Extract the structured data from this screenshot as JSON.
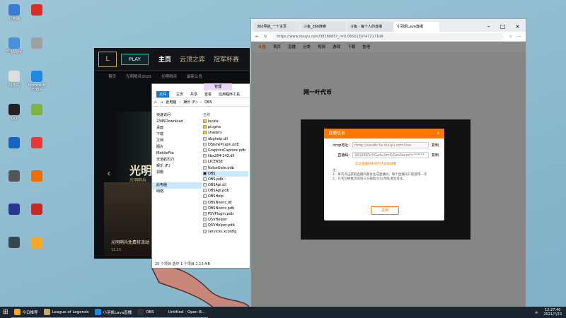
{
  "desktop_icons": [
    {
      "label": "此电脑",
      "color": "#3a7bd5"
    },
    {
      "label": "",
      "color": "#d93025"
    },
    {
      "label": "控制面板",
      "color": "#4a90d9"
    },
    {
      "label": "",
      "color": "#a0a0a0"
    },
    {
      "label": "回收站",
      "color": "#dddddd"
    },
    {
      "label": "Microsoft Edge",
      "color": "#1e88e5"
    },
    {
      "label": "QQ",
      "color": "#222222"
    },
    {
      "label": "",
      "color": "#7cb342"
    },
    {
      "label": "",
      "color": "#1565c0"
    },
    {
      "label": "",
      "color": "#e53935"
    },
    {
      "label": "",
      "color": "#555555"
    },
    {
      "label": "",
      "color": "#ef6c00"
    },
    {
      "label": "",
      "color": "#283593"
    },
    {
      "label": "",
      "color": "#c62828"
    },
    {
      "label": "",
      "color": "#37474f"
    },
    {
      "label": "",
      "color": "#f9a825"
    }
  ],
  "lol": {
    "play": "PLAY",
    "tabs": [
      "主页",
      "云顶之弈",
      "冠军杯赛"
    ],
    "subnav": [
      "首页",
      "光明哨兵2021",
      "光明哨兵",
      "最新公告"
    ],
    "hero_title": "光明",
    "hero_sub": "光明哨兵",
    "news_caption": "光明哨兵免费将活动",
    "news_date": "11.15"
  },
  "explorer": {
    "manage": "管理",
    "tabs": [
      "文件",
      "主页",
      "共享",
      "查看",
      "应用程序工具"
    ],
    "path": [
      "此电脑",
      "娱乐 (F:)",
      "OBS"
    ],
    "nav": [
      "快速访问",
      "2345Download",
      "桌面",
      "下载",
      "文档",
      "图片",
      "MobileFile",
      "天道航司刀",
      "娱乐 (F:)",
      "洞箱",
      "",
      "此电脑",
      "网络"
    ],
    "column": "名称",
    "files": [
      {
        "name": "locale",
        "type": "folder"
      },
      {
        "name": "plugins",
        "type": "folder"
      },
      {
        "name": "shaders",
        "type": "folder"
      },
      {
        "name": "dbghelp.dll",
        "type": "file"
      },
      {
        "name": "DShowPlugin.pdb",
        "type": "file"
      },
      {
        "name": "GraphicsCapture.pdb",
        "type": "file"
      },
      {
        "name": "libx264-142.dll",
        "type": "file"
      },
      {
        "name": "LICENSE",
        "type": "file"
      },
      {
        "name": "NoiseGate.pdb",
        "type": "file"
      },
      {
        "name": "OBS",
        "type": "exe"
      },
      {
        "name": "OBS.pdb",
        "type": "file"
      },
      {
        "name": "OBSApi.dll",
        "type": "file"
      },
      {
        "name": "OBSApi.pdb",
        "type": "file"
      },
      {
        "name": "OBSHelp",
        "type": "file"
      },
      {
        "name": "OBSNvenc.dll",
        "type": "file"
      },
      {
        "name": "OBSNvenc.pdb",
        "type": "file"
      },
      {
        "name": "PSVPlugin.pdb",
        "type": "file"
      },
      {
        "name": "QSVHelper",
        "type": "file"
      },
      {
        "name": "QSVHelper.pdb",
        "type": "file"
      },
      {
        "name": "services.xconfig",
        "type": "file"
      }
    ],
    "status": "20 个项目    选中 1 个项目  1.13 MB"
  },
  "edge": {
    "tabs": [
      "360导航_一个主页",
      "斗鱼_360搜索",
      "斗鱼 - 每个人的直播",
      "小羽凯Lava直播"
    ],
    "url": "https://www.douyu.com/3816665?_r=0.0650139747217108",
    "nav": [
      "首页",
      "直播",
      "分类",
      "视频",
      "游戏",
      "下载",
      "鱼吧"
    ],
    "room_name": "网一叶代币",
    "dialog": {
      "title": "直播信息",
      "close": "×",
      "rtmp_label": "rtmp地址:",
      "rtmp_value": "rtmp://sendtc3a.douyu.com/live",
      "key_label": "直播码:",
      "key_value": "3816665rDGa4uVmDZwsSecret=******",
      "copy": "复制",
      "link": "启动直播码失效时点此处获取",
      "note_head": "注:",
      "note1": "1、每次点击获取直播码都会生成直播码，每个直播码只能使用一次",
      "note2": "2、只有切换推流或第三方辅助rtmp地址发生变化。",
      "ok": "关闭"
    }
  },
  "taskbar": {
    "items": [
      "今日推荐",
      "League of Legends",
      "小羽凯Lava直播",
      "OBS",
      "Untitled - Open B..."
    ],
    "time": "12:27:40",
    "date": "2021/7/23"
  }
}
